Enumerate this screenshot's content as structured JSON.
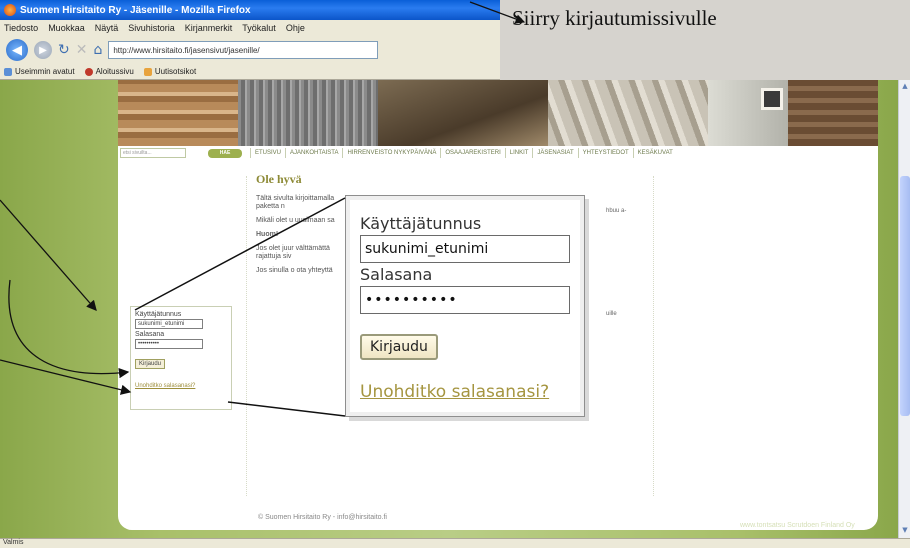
{
  "browser": {
    "title": "Suomen Hirsitaito Ry - Jäsenille - Mozilla Firefox",
    "menu": [
      "Tiedosto",
      "Muokkaa",
      "Näytä",
      "Sivuhistoria",
      "Kirjanmerkit",
      "Työkalut",
      "Ohje"
    ],
    "url": "http://www.hirsitaito.fi/jasensivut/jasenille/",
    "bookmarks": [
      "Useimmin avatut",
      "Aloitussivu",
      "Uutisotsikot"
    ],
    "status": "Valmis"
  },
  "annotation": {
    "text": "Siirry kirjautumissivulle"
  },
  "site": {
    "search_placeholder": "etsi sivuilta...",
    "search_button": "HAE",
    "nav": [
      "ETUSIVU",
      "AJANKOHTAISTA",
      "HIRRENVEISTO NYKYPÄIVÄNÄ",
      "OSAAJAREKISTERI",
      "LINKIT",
      "JÄSENASIAT",
      "YHTEYSTIEDOT",
      "KESÄKUVAT"
    ],
    "heading": "Ole hyvä",
    "p1": "Tältä sivulta kirjoittamalla paketta n",
    "p2": "Mikäli olet u uusimaan sa",
    "huom": "Huom!",
    "p3": "Jos olet juur välttämättä rajattuja siv",
    "p4": "Jos sinulla o ota yhteyttä",
    "right1": "hbuu a-",
    "right2": "uille",
    "footer": "© Suomen Hirsitaito Ry - info@hirsitaito.fi",
    "credit": "www.tontsatsu Scrutdoen Finland Oy"
  },
  "login_small": {
    "username_label": "Käyttäjätunnus",
    "username_value": "sukunimi_etunimi",
    "password_label": "Salasana",
    "password_value": "••••••••••",
    "button": "Kirjaudu",
    "forgot": "Unohditko salasanasi?"
  },
  "login_zoom": {
    "username_label": "Käyttäjätunnus",
    "username_value": "sukunimi_etunimi",
    "password_label": "Salasana",
    "password_value": "••••••••••",
    "button": "Kirjaudu",
    "forgot": "Unohditko salasanasi?"
  }
}
